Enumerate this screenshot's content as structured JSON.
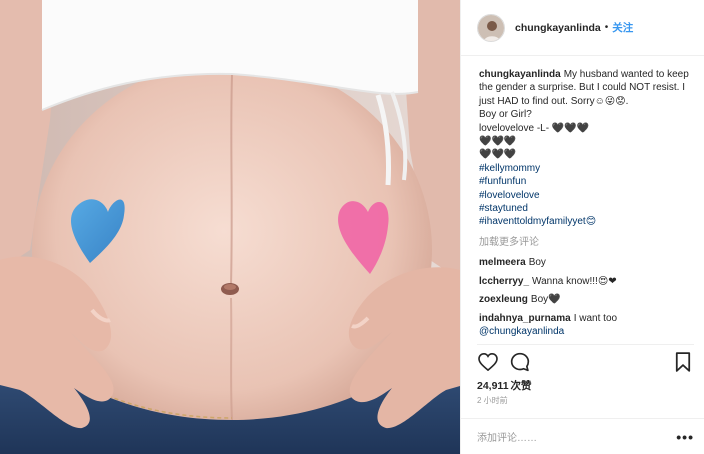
{
  "post": {
    "username": "chungkayanlinda",
    "follow_separator": "•",
    "follow_label": "关注"
  },
  "caption": {
    "username": "chungkayanlinda",
    "lines": [
      "My husband wanted to keep the gender a surprise. But I could NOT resist. I just HAD to find out. Sorry☺😜😟.",
      "Boy or Girl?",
      "lovelovelove -L- 🖤🖤🖤",
      "🖤🖤🖤",
      "🖤🖤🖤"
    ],
    "hashtags": [
      "#kellymommy",
      "#funfunfun",
      "#lovelovelove",
      "#staytuned",
      "#ihaventtoldmyfamilyyet😊"
    ]
  },
  "load_more": "加载更多评论",
  "comments": [
    {
      "user": "melmeera",
      "text": "Boy"
    },
    {
      "user": "lccherryy_",
      "text": "Wanna know!!!😍❤"
    },
    {
      "user": "zoexleung",
      "text": "Boy🖤"
    },
    {
      "user": "indahnya_purnama",
      "text": "I want too",
      "mention": "@chungkayanlinda"
    }
  ],
  "likes": {
    "count": "24,911",
    "label": "次赞"
  },
  "timestamp": "2 小时前",
  "add_comment_placeholder": "添加评论……",
  "more_label": "•••",
  "icons": {
    "like": "heart-icon",
    "comment": "comment-bubble-icon",
    "save": "bookmark-icon"
  },
  "colors": {
    "link_blue": "#3897f0",
    "hashtag_blue": "#003569",
    "heart_blue": "#3a8fd6",
    "heart_pink": "#f06aa6"
  }
}
